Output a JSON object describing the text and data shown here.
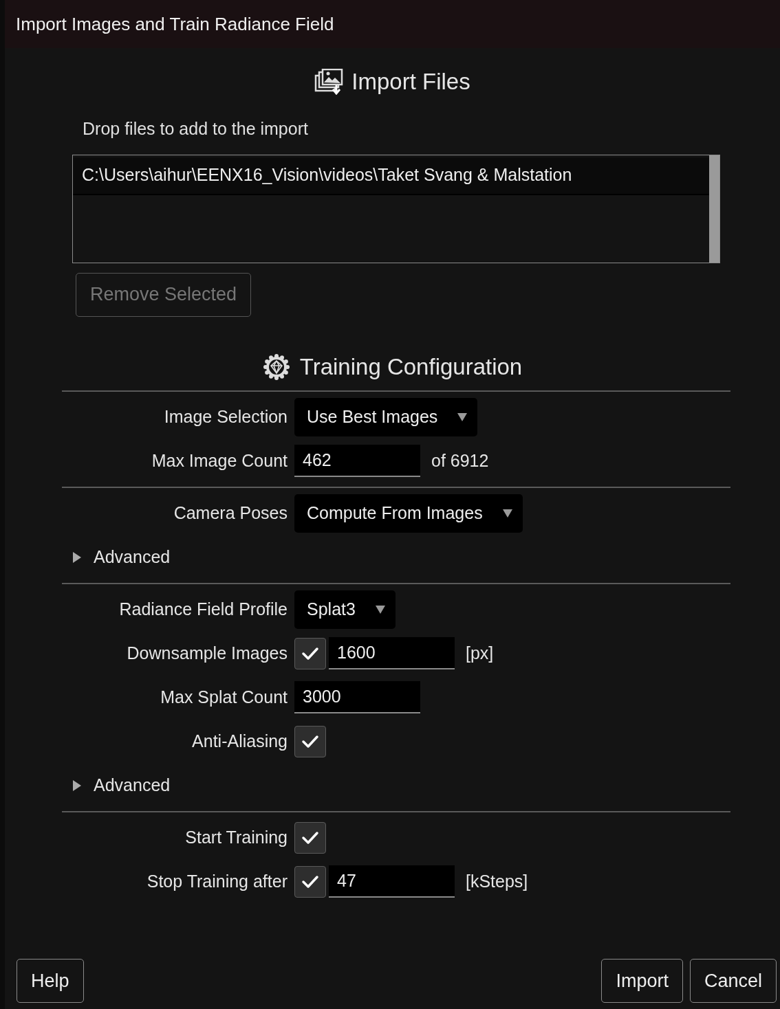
{
  "window": {
    "title": "Import Images and Train Radiance Field"
  },
  "import_files": {
    "heading": "Import Files",
    "hint": "Drop files to add to the import",
    "files": [
      {
        "path": "C:\\Users\\aihur\\EENX16_Vision\\videos\\Taket Svang & Malstation",
        "selected": true
      }
    ],
    "remove_button": {
      "label": "Remove Selected",
      "disabled": true
    }
  },
  "training": {
    "heading": "Training Configuration",
    "groups": [
      {
        "rows": [
          {
            "kind": "dropdown",
            "label": "Image Selection",
            "value": "Use Best Images"
          },
          {
            "kind": "number",
            "label": "Max Image Count",
            "value": "462",
            "suffix": "of 6912"
          }
        ]
      },
      {
        "rows": [
          {
            "kind": "dropdown",
            "label": "Camera Poses",
            "value": "Compute From Images"
          }
        ],
        "advanced": {
          "label": "Advanced",
          "expanded": false
        }
      },
      {
        "rows": [
          {
            "kind": "dropdown",
            "label": "Radiance Field Profile",
            "value": "Splat3"
          },
          {
            "kind": "check_number",
            "label": "Downsample Images",
            "checked": true,
            "value": "1600",
            "suffix": "[px]"
          },
          {
            "kind": "number",
            "label": "Max Splat Count",
            "value": "3000"
          },
          {
            "kind": "check",
            "label": "Anti-Aliasing",
            "checked": true
          }
        ],
        "advanced": {
          "label": "Advanced",
          "expanded": false
        }
      },
      {
        "rows": [
          {
            "kind": "check",
            "label": "Start Training",
            "checked": true
          },
          {
            "kind": "check_number",
            "label": "Stop Training after",
            "checked": true,
            "value": "47",
            "suffix": "[kSteps]"
          }
        ]
      }
    ]
  },
  "buttons": {
    "left": [
      {
        "label": "Help"
      }
    ],
    "right": [
      {
        "label": "Import"
      },
      {
        "label": "Cancel"
      }
    ]
  }
}
